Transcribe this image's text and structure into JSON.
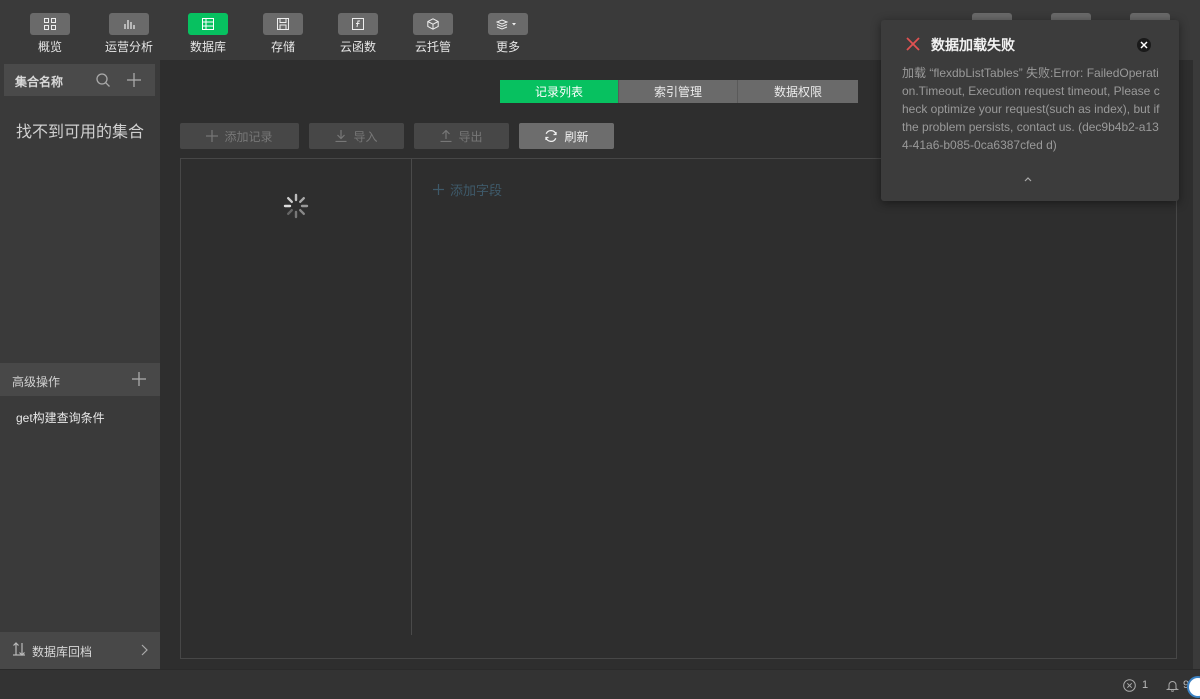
{
  "toolbar": {
    "items": [
      {
        "label": "概览",
        "icon": "overview-grid-icon",
        "active": false
      },
      {
        "label": "运营分析",
        "icon": "bar-chart-icon",
        "active": false
      },
      {
        "label": "数据库",
        "icon": "database-icon",
        "active": true
      },
      {
        "label": "存储",
        "icon": "storage-save-icon",
        "active": false
      },
      {
        "label": "云函数",
        "icon": "cloud-function-icon",
        "active": false
      },
      {
        "label": "云托管",
        "icon": "cloud-hosting-box-icon",
        "active": false
      },
      {
        "label": "更多",
        "icon": "layers-more-icon",
        "active": false
      }
    ]
  },
  "sidebar": {
    "header_title": "集合名称",
    "empty_text": "找不到可用的集合",
    "advanced": {
      "title": "高级操作",
      "items": [
        "get构建查询条件"
      ]
    },
    "rollback_label": "数据库回档"
  },
  "tabs": [
    {
      "label": "记录列表",
      "active": true
    },
    {
      "label": "索引管理",
      "active": false
    },
    {
      "label": "数据权限",
      "active": false
    }
  ],
  "actions": {
    "add_record": "添加记录",
    "import": "导入",
    "export": "导出",
    "refresh": "刷新"
  },
  "content": {
    "add_field": "添加字段"
  },
  "toast": {
    "title": "数据加载失败",
    "message": "加载 “flexdbListTables” 失败:Error: FailedOperation.Timeout, Execution request timeout, Please check optimize your request(such as index), but if the problem persists, contact us. (dec9b4b2-a134-41a6-b085-0ca6387cfed d)"
  },
  "statusbar": {
    "error_count": "1",
    "notification_count": "9"
  },
  "colors": {
    "accent": "#07c160",
    "error": "#e05252"
  }
}
